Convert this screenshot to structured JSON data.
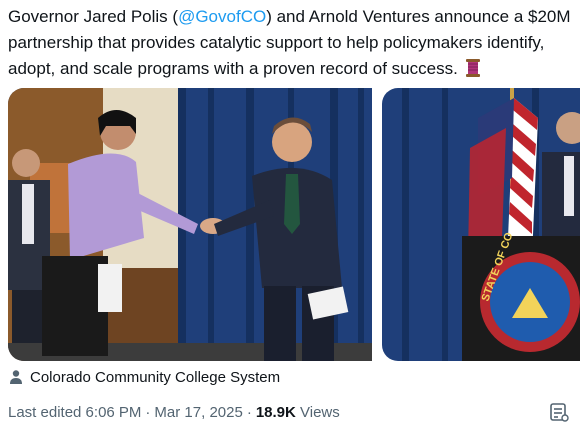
{
  "tweet": {
    "text_before": "Governor Jared Polis (",
    "mention": "@GovofCO",
    "text_after": ") and Arnold Ventures announce a $20M partnership that provides catalytic support to help policymakers identify, adopt, and scale programs with a proven record of success.",
    "emoji_icon": "thread-spool-emoji"
  },
  "media": {
    "photo_1_icon": "handshake-photo",
    "photo_2_icon": "podium-with-seal-photo",
    "seal_text": "STATE OF CO"
  },
  "tag": {
    "icon": "person-icon",
    "label": "Colorado Community College System"
  },
  "meta": {
    "edited": "Last edited 6:06 PM",
    "sep1": "·",
    "date": "Mar 17, 2025",
    "sep2": "·",
    "views_count": "18.9K",
    "views_label": "Views",
    "action_icon": "post-analytics-icon"
  },
  "colors": {
    "text": "#0f1419",
    "secondary": "#536471",
    "link": "#1d9bf0",
    "curtain": "#1f3f7a",
    "blazer": "#b29ad6"
  }
}
